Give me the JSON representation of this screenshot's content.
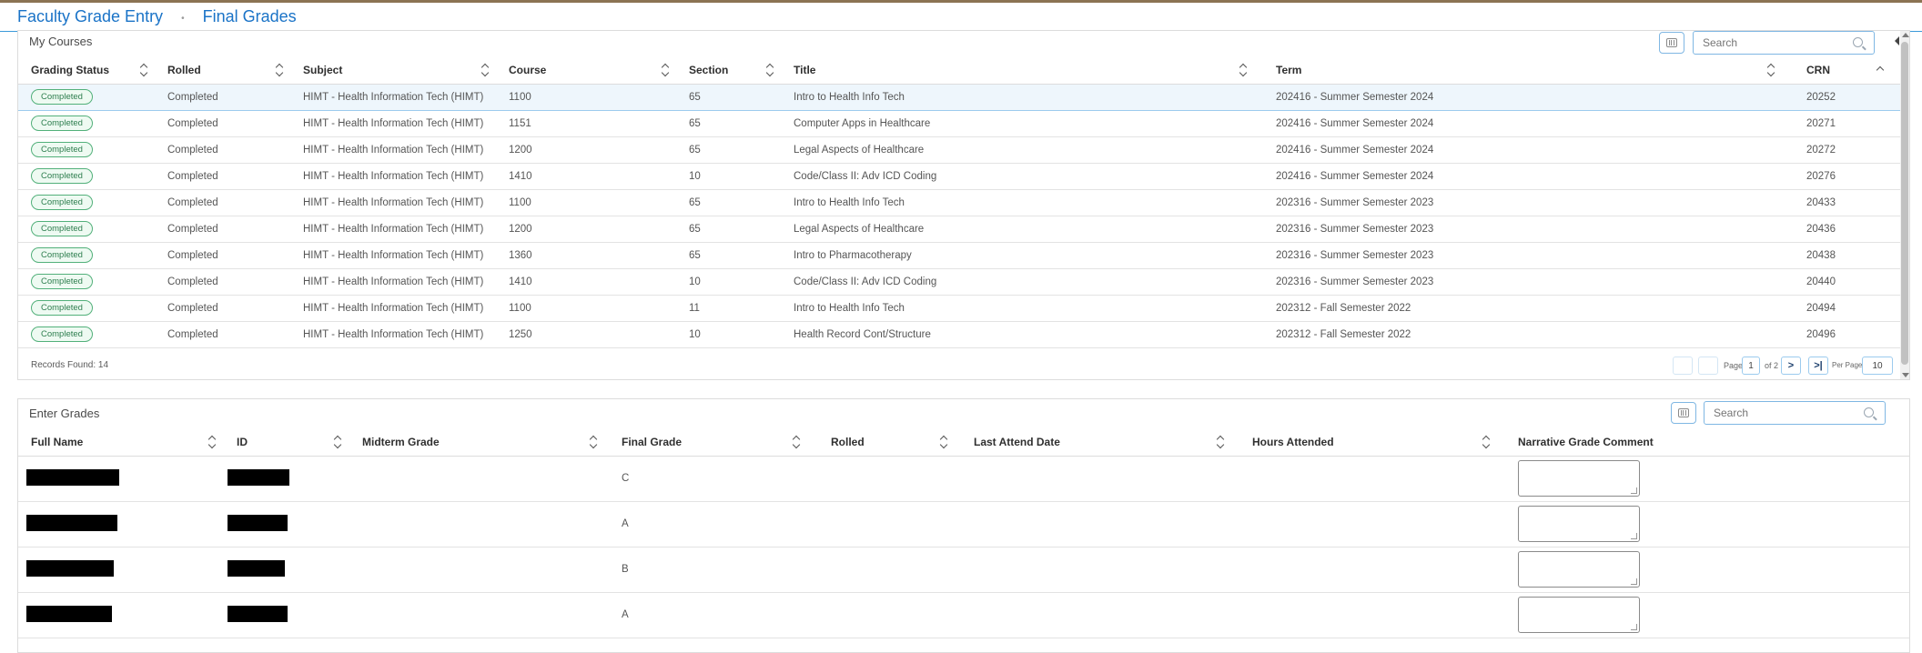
{
  "breadcrumb": {
    "items": [
      "Faculty Grade Entry",
      "Final Grades"
    ],
    "separator": "•"
  },
  "courses": {
    "title": "My Courses",
    "search_placeholder": "Search",
    "columns": [
      "Grading Status",
      "Rolled",
      "Subject",
      "Course",
      "Section",
      "Title",
      "Term",
      "CRN"
    ],
    "rows": [
      [
        "Completed",
        "Completed",
        "HIMT - Health Information Tech (HIMT)",
        "1100",
        "65",
        "Intro to Health Info Tech",
        "202416 - Summer Semester 2024",
        "20252"
      ],
      [
        "Completed",
        "Completed",
        "HIMT - Health Information Tech (HIMT)",
        "1151",
        "65",
        "Computer Apps in Healthcare",
        "202416 - Summer Semester 2024",
        "20271"
      ],
      [
        "Completed",
        "Completed",
        "HIMT - Health Information Tech (HIMT)",
        "1200",
        "65",
        "Legal Aspects of Healthcare",
        "202416 - Summer Semester 2024",
        "20272"
      ],
      [
        "Completed",
        "Completed",
        "HIMT - Health Information Tech (HIMT)",
        "1410",
        "10",
        "Code/Class II: Adv ICD Coding",
        "202416 - Summer Semester 2024",
        "20276"
      ],
      [
        "Completed",
        "Completed",
        "HIMT - Health Information Tech (HIMT)",
        "1100",
        "65",
        "Intro to Health Info Tech",
        "202316 - Summer Semester 2023",
        "20433"
      ],
      [
        "Completed",
        "Completed",
        "HIMT - Health Information Tech (HIMT)",
        "1200",
        "65",
        "Legal Aspects of Healthcare",
        "202316 - Summer Semester 2023",
        "20436"
      ],
      [
        "Completed",
        "Completed",
        "HIMT - Health Information Tech (HIMT)",
        "1360",
        "65",
        "Intro to Pharmacotherapy",
        "202316 - Summer Semester 2023",
        "20438"
      ],
      [
        "Completed",
        "Completed",
        "HIMT - Health Information Tech (HIMT)",
        "1410",
        "10",
        "Code/Class II: Adv ICD Coding",
        "202316 - Summer Semester 2023",
        "20440"
      ],
      [
        "Completed",
        "Completed",
        "HIMT - Health Information Tech (HIMT)",
        "1100",
        "11",
        "Intro to Health Info Tech",
        "202312 - Fall Semester 2022",
        "20494"
      ],
      [
        "Completed",
        "Completed",
        "HIMT - Health Information Tech (HIMT)",
        "1250",
        "10",
        "Health Record Cont/Structure",
        "202312 - Fall Semester 2022",
        "20496"
      ]
    ],
    "records_found": "Records Found: 14",
    "pager": {
      "page_label": "Page",
      "page": "1",
      "of_label": "of 2",
      "next": ">",
      "last": ">|",
      "per_page_label": "Per Page",
      "per_page": "10"
    }
  },
  "grades": {
    "title": "Enter Grades",
    "search_placeholder": "Search",
    "columns": [
      "Full Name",
      "ID",
      "Midterm Grade",
      "Final Grade",
      "Rolled",
      "Last Attend Date",
      "Hours Attended",
      "Narrative Grade Comment"
    ],
    "rows": [
      {
        "final_grade": "C"
      },
      {
        "final_grade": "A"
      },
      {
        "final_grade": "B"
      },
      {
        "final_grade": "A"
      }
    ]
  }
}
